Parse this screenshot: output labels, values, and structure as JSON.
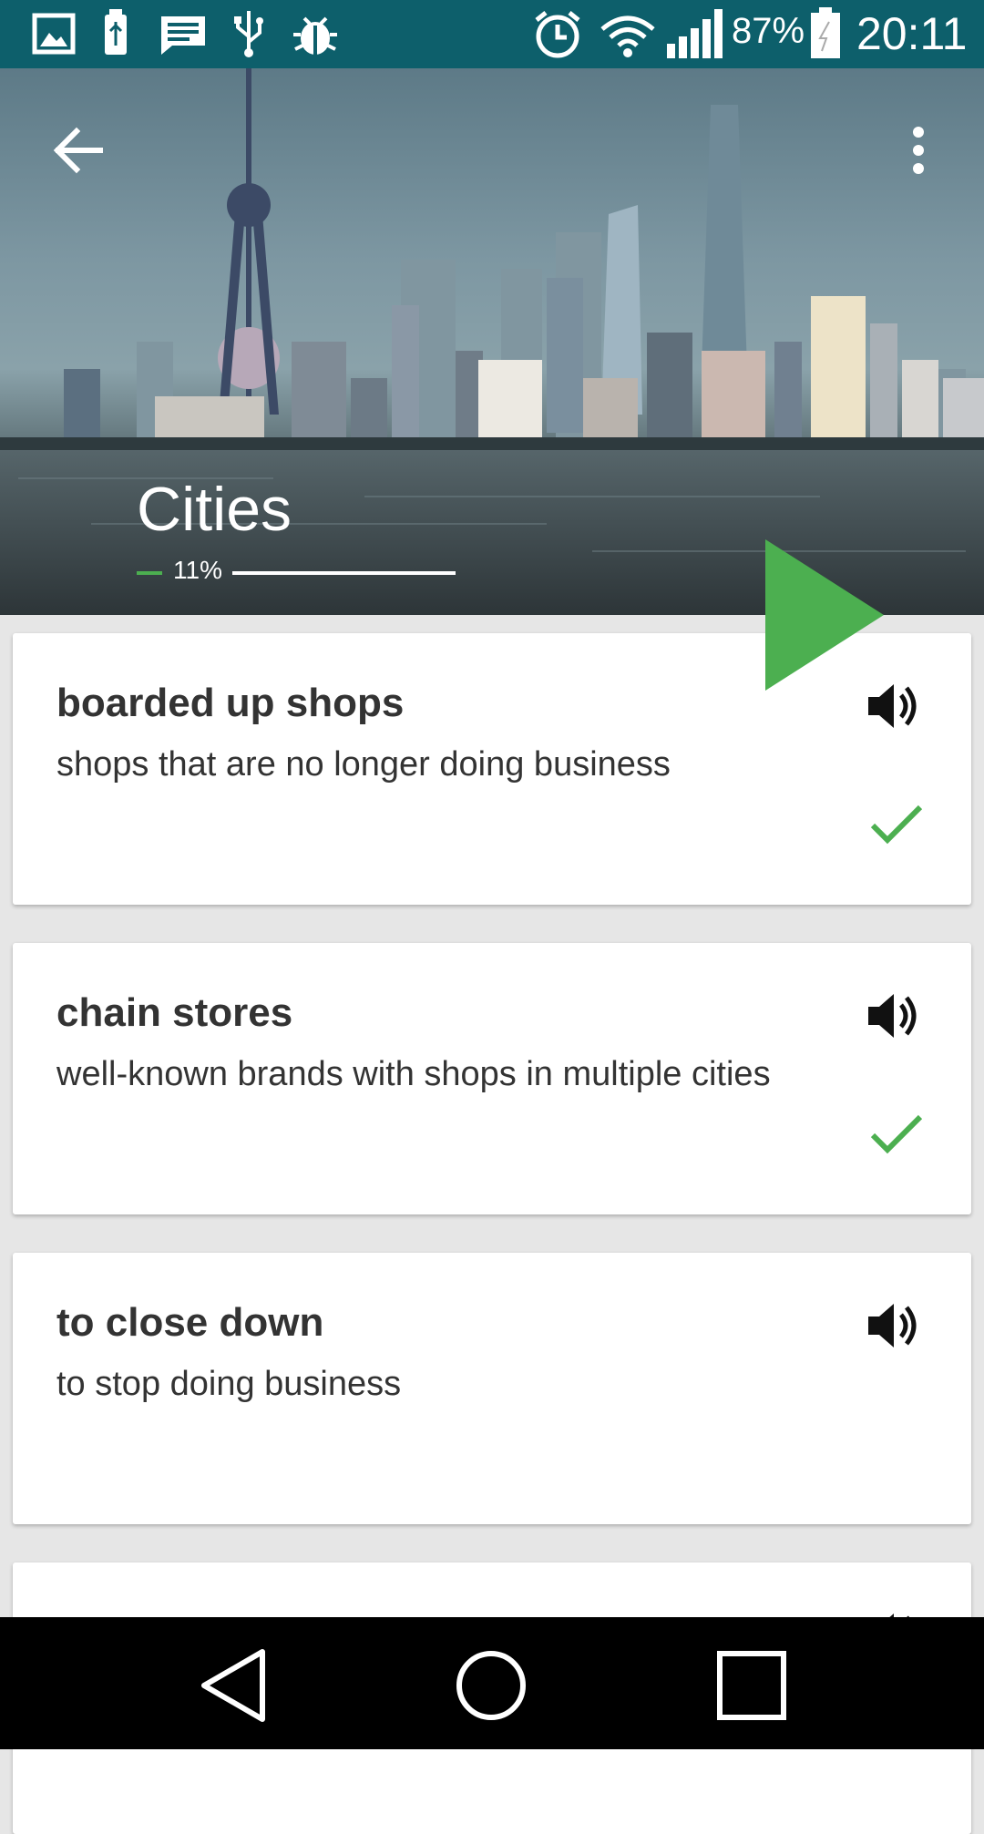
{
  "status_bar": {
    "battery": "87%",
    "time": "20:11",
    "icons": [
      "image-icon",
      "usb-storage-icon",
      "message-icon",
      "usb-icon",
      "bug-icon",
      "alarm-icon",
      "wifi-icon",
      "signal-icon",
      "battery-icon"
    ]
  },
  "header": {
    "title": "Cities",
    "progress_text": "11%",
    "progress_value": 0.11,
    "accent_color": "#4caf50"
  },
  "cards": [
    {
      "term": "boarded up shops",
      "definition": "shops that are no longer doing business",
      "learned": true
    },
    {
      "term": "chain stores",
      "definition": "well-known brands with shops in multiple cities",
      "learned": true
    },
    {
      "term": "to close down",
      "definition": "to stop doing business",
      "learned": false
    }
  ]
}
